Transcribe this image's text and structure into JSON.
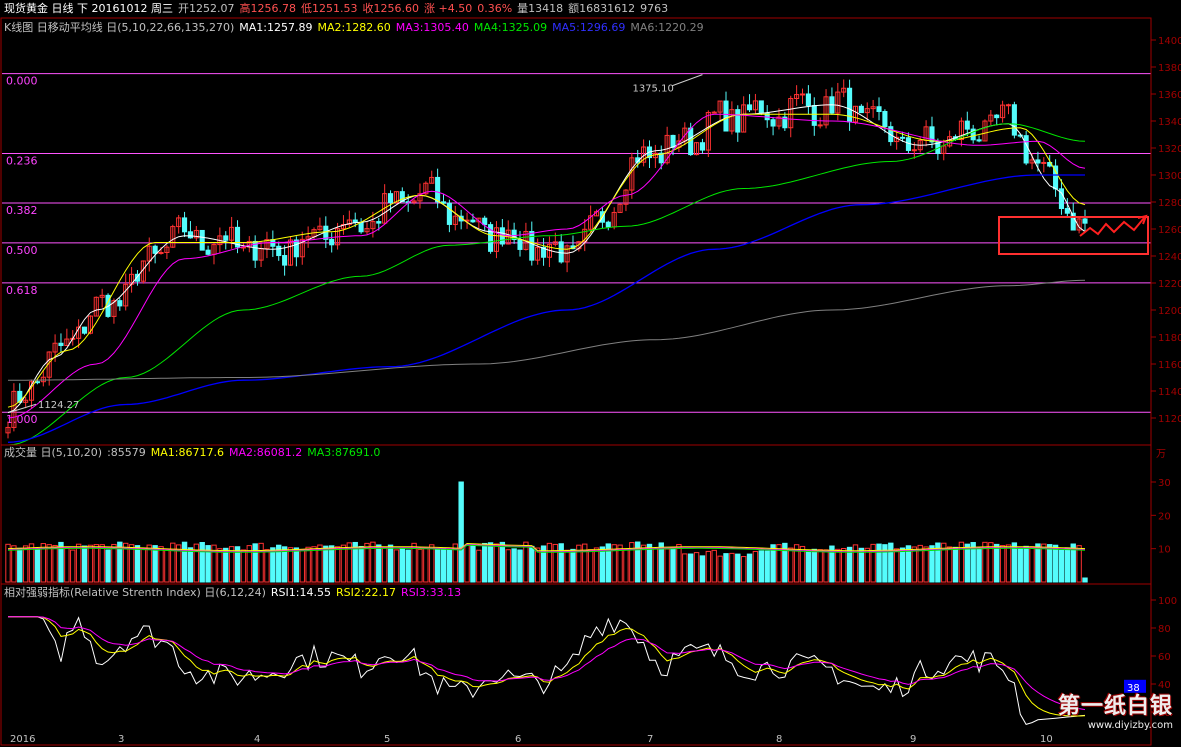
{
  "colors": {
    "up": "#ff3232",
    "down": "#54fcfc",
    "ma1": "#ffffff",
    "ma2": "#ffff00",
    "ma3": "#ff00ff",
    "ma4": "#00e600",
    "ma5": "#0000ff",
    "ma6": "#808080",
    "grid": "#ff55ff",
    "axis": "#a00000"
  },
  "header": {
    "title": "现货黄金 日线 下 20161012 周三",
    "open": "开1252.07",
    "high": "高1256.78",
    "low": "低1251.53",
    "close": "收1256.60",
    "change": "涨 +4.50",
    "pct": "0.36%",
    "volume": "量13418",
    "amount": "额16831612",
    "extra": "9763"
  },
  "ma_legend": {
    "name": "K线图 日移动平均线 日(5,10,22,66,135,270)",
    "ma1": "MA1:1257.89",
    "ma2": "MA2:1282.60",
    "ma3": "MA3:1305.40",
    "ma4": "MA4:1325.09",
    "ma5": "MA5:1296.69",
    "ma6": "MA6:1220.29"
  },
  "vol_legend": {
    "name": "成交量 日(5,10,20)",
    "vol": ":85579",
    "ma1": "MA1:86717.6",
    "ma2": "MA2:86081.2",
    "ma3": "MA3:87691.0"
  },
  "rsi_legend": {
    "name": "相对强弱指标(Relative Strenth Index) 日(6,12,24)",
    "rsi1": "RSI1:14.55",
    "rsi2": "RSI2:22.17",
    "rsi3": "RSI3:33.13"
  },
  "fib_labels": [
    "0.000",
    "0.236",
    "0.382",
    "0.500",
    "0.618",
    "1.000"
  ],
  "annotations": {
    "high": "1375.10",
    "low": "1124.27"
  },
  "vol_unit": "万",
  "rsi_badge": "38",
  "watermark": {
    "title": "第一纸白银",
    "url": "www.diyizby.com"
  },
  "chart_data": [
    {
      "type": "candlestick",
      "y_ticks": [
        1120,
        1140,
        1160,
        1180,
        1200,
        1220,
        1240,
        1260,
        1280,
        1300,
        1320,
        1340,
        1360,
        1380,
        1400
      ],
      "ylim": [
        1100,
        1400
      ],
      "fib_levels": [
        1375.1,
        1315.9,
        1279.3,
        1249.7,
        1220.1,
        1124.27
      ],
      "x_ticks": [
        "2016",
        "3",
        "4",
        "5",
        "6",
        "7",
        "8",
        "9",
        "10"
      ],
      "ma_anchors": {
        "ma1": [
          [
            0,
            1124
          ],
          [
            8,
            1165
          ],
          [
            15,
            1200
          ],
          [
            30,
            1255
          ],
          [
            45,
            1245
          ],
          [
            60,
            1265
          ],
          [
            70,
            1285
          ],
          [
            82,
            1258
          ],
          [
            95,
            1242
          ],
          [
            110,
            1318
          ],
          [
            125,
            1345
          ],
          [
            140,
            1352
          ],
          [
            155,
            1322
          ],
          [
            170,
            1338
          ],
          [
            178,
            1290
          ],
          [
            183,
            1258
          ]
        ],
        "ma2": [
          [
            0,
            1128
          ],
          [
            10,
            1170
          ],
          [
            25,
            1250
          ],
          [
            40,
            1250
          ],
          [
            55,
            1258
          ],
          [
            70,
            1285
          ],
          [
            83,
            1255
          ],
          [
            95,
            1245
          ],
          [
            110,
            1315
          ],
          [
            125,
            1345
          ],
          [
            140,
            1345
          ],
          [
            158,
            1325
          ],
          [
            172,
            1335
          ],
          [
            183,
            1278
          ]
        ],
        "ma3": [
          [
            0,
            1120
          ],
          [
            15,
            1160
          ],
          [
            30,
            1238
          ],
          [
            45,
            1250
          ],
          [
            60,
            1255
          ],
          [
            72,
            1288
          ],
          [
            85,
            1255
          ],
          [
            95,
            1260
          ],
          [
            105,
            1285
          ],
          [
            120,
            1345
          ],
          [
            140,
            1340
          ],
          [
            165,
            1322
          ],
          [
            175,
            1325
          ],
          [
            183,
            1305
          ]
        ],
        "ma4": [
          [
            0,
            1100
          ],
          [
            20,
            1150
          ],
          [
            40,
            1200
          ],
          [
            60,
            1225
          ],
          [
            75,
            1248
          ],
          [
            92,
            1255
          ],
          [
            105,
            1262
          ],
          [
            125,
            1290
          ],
          [
            150,
            1310
          ],
          [
            170,
            1338
          ],
          [
            183,
            1325
          ]
        ],
        "ma5": [
          [
            0,
            1102
          ],
          [
            20,
            1130
          ],
          [
            40,
            1148
          ],
          [
            65,
            1158
          ],
          [
            95,
            1200
          ],
          [
            120,
            1245
          ],
          [
            145,
            1278
          ],
          [
            175,
            1300
          ],
          [
            183,
            1300
          ]
        ],
        "ma6": [
          [
            0,
            1148
          ],
          [
            40,
            1150
          ],
          [
            80,
            1160
          ],
          [
            110,
            1178
          ],
          [
            140,
            1200
          ],
          [
            170,
            1218
          ],
          [
            183,
            1222
          ]
        ]
      }
    },
    {
      "type": "bar",
      "name": "volume",
      "y_ticks": [
        10,
        20,
        30
      ],
      "ylim": [
        0,
        36
      ],
      "spike": 30
    },
    {
      "type": "line",
      "name": "RSI",
      "y_ticks": [
        20,
        40,
        60,
        80,
        100
      ],
      "ylim": [
        0,
        100
      ],
      "last": [
        14.55,
        22.17,
        33.13
      ]
    }
  ]
}
